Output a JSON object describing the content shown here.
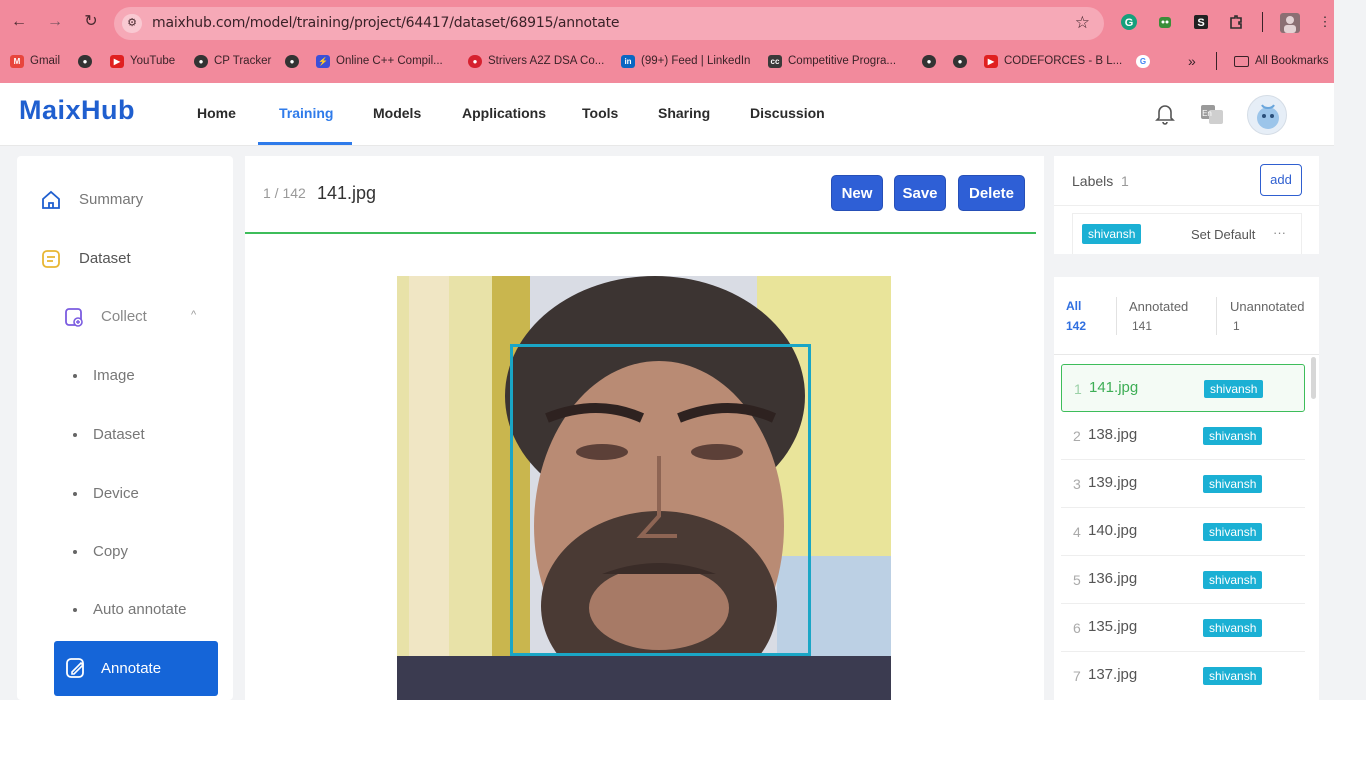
{
  "browser": {
    "url": "maixhub.com/model/training/project/64417/dataset/68915/annotate",
    "bookmarks": [
      {
        "label": "Gmail"
      },
      {
        "label": "YouTube"
      },
      {
        "label": "CP Tracker"
      },
      {
        "label": "Online C++ Compil..."
      },
      {
        "label": "Strivers A2Z DSA Co..."
      },
      {
        "label": "(99+) Feed | LinkedIn"
      },
      {
        "label": "Competitive Progra..."
      },
      {
        "label": "CODEFORCES - B L..."
      }
    ],
    "overflow": "»",
    "all_bookmarks": "All Bookmarks"
  },
  "app": {
    "logo": "MaixHub",
    "nav": [
      "Home",
      "Training",
      "Models",
      "Applications",
      "Tools",
      "Sharing",
      "Discussion"
    ],
    "active_nav": "Training",
    "lang_icon_text": "En"
  },
  "sidebar": {
    "summary": "Summary",
    "dataset": "Dataset",
    "collect": "Collect",
    "collect_items": [
      "Image",
      "Dataset",
      "Device",
      "Copy",
      "Auto annotate"
    ],
    "annotate": "Annotate"
  },
  "editor": {
    "counter": "1 / 142",
    "filename": "141.jpg",
    "buttons": {
      "new": "New",
      "save": "Save",
      "delete": "Delete"
    },
    "box_label": "shivansh"
  },
  "labels_panel": {
    "title": "Labels",
    "count": "1",
    "add": "add",
    "label": "shivansh",
    "set_default": "Set Default",
    "more": "···"
  },
  "files_panel": {
    "tabs": [
      {
        "label": "All",
        "count": "142"
      },
      {
        "label": "Annotated",
        "count": "141"
      },
      {
        "label": "Unannotated",
        "count": "1"
      }
    ],
    "files": [
      {
        "num": "1",
        "name": "141.jpg",
        "tag": "shivansh"
      },
      {
        "num": "2",
        "name": "138.jpg",
        "tag": "shivansh"
      },
      {
        "num": "3",
        "name": "139.jpg",
        "tag": "shivansh"
      },
      {
        "num": "4",
        "name": "140.jpg",
        "tag": "shivansh"
      },
      {
        "num": "5",
        "name": "136.jpg",
        "tag": "shivansh"
      },
      {
        "num": "6",
        "name": "135.jpg",
        "tag": "shivansh"
      },
      {
        "num": "7",
        "name": "137.jpg",
        "tag": "shivansh"
      }
    ]
  },
  "colors": {
    "browser_chrome": "#f28a9c",
    "brand": "#1f5fcf",
    "active_nav": "#2f7bea",
    "primary_button": "#2e5fd6",
    "annotate_active": "#1565d8",
    "tag": "#1bb0d4",
    "bbox": "#1aa6c6",
    "selected": "#3dbd5a"
  }
}
